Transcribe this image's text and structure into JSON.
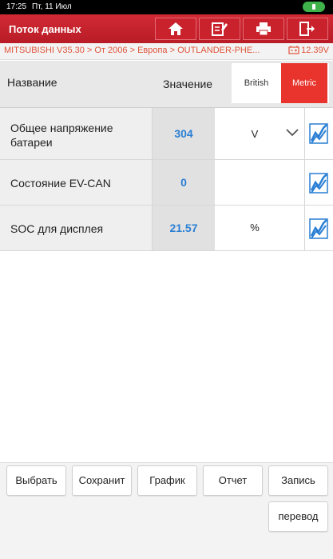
{
  "status": {
    "time": "17:25",
    "date": "Пт, 11 Июл"
  },
  "titlebar": {
    "title": "Поток данных",
    "icons": [
      "home-icon",
      "edit-icon",
      "print-icon",
      "exit-icon"
    ]
  },
  "breadcrumb": {
    "path": "MITSUBISHI V35.30 > От 2006 > Европа  > OUTLANDER-PHE...",
    "voltage": "12.39V"
  },
  "header": {
    "name": "Название",
    "t_icon": "T",
    "value": "Значение",
    "british": "British",
    "metric": "Metric"
  },
  "rows": [
    {
      "name_line1": "Общее напряжение",
      "name_line2": "батареи",
      "value": "304",
      "unit": "V"
    },
    {
      "name_line1": "Состояние EV-CAN",
      "name_line2": "",
      "value": "0",
      "unit": ""
    },
    {
      "name_line1": "SOC для дисплея",
      "name_line2": "",
      "value": "21.57",
      "unit": "%"
    }
  ],
  "buttons": {
    "select": "Выбрать",
    "save": "Сохранит",
    "graph": "График",
    "report": "Отчет",
    "record": "Запись",
    "translate": "перевод"
  },
  "colors": {
    "accent": "#c9222d",
    "metric": "#e8342c",
    "value": "#2a7fd4",
    "breadcrumb": "#e0533a"
  }
}
